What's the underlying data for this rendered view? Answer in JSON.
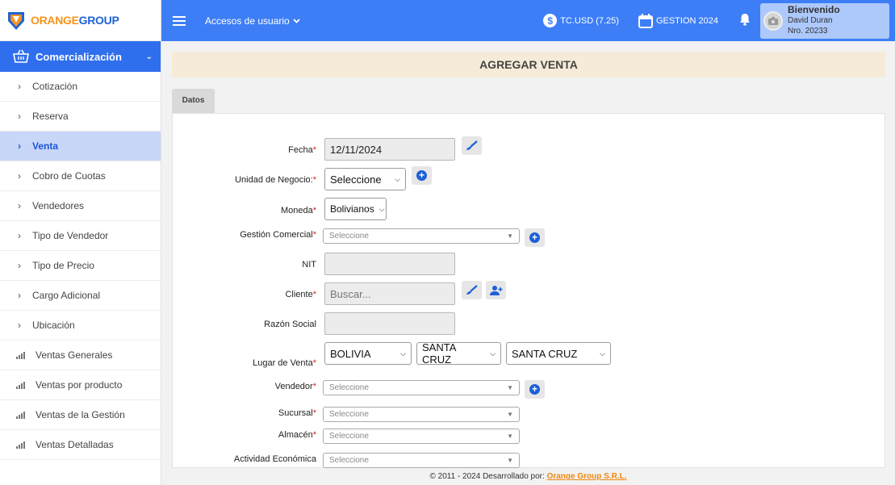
{
  "brand": {
    "name_a": "ORANGE",
    "name_b": "GROUP"
  },
  "sidebar": {
    "section": "Comercialización",
    "items": [
      {
        "label": "Cotización",
        "kind": "chevron"
      },
      {
        "label": "Reserva",
        "kind": "chevron"
      },
      {
        "label": "Venta",
        "kind": "chevron",
        "active": true
      },
      {
        "label": "Cobro de Cuotas",
        "kind": "chevron"
      },
      {
        "label": "Vendedores",
        "kind": "chevron"
      },
      {
        "label": "Tipo de Vendedor",
        "kind": "chevron"
      },
      {
        "label": "Tipo de Precio",
        "kind": "chevron"
      },
      {
        "label": "Cargo Adicional",
        "kind": "chevron"
      },
      {
        "label": "Ubicación",
        "kind": "chevron"
      },
      {
        "label": "Ventas Generales",
        "kind": "chart"
      },
      {
        "label": "Ventas por producto",
        "kind": "chart"
      },
      {
        "label": "Ventas de la Gestión",
        "kind": "chart"
      },
      {
        "label": "Ventas Detalladas",
        "kind": "chart"
      }
    ]
  },
  "topbar": {
    "accesos": "Accesos de usuario",
    "tc": "TC.USD (7.25)",
    "gestion": "GESTION 2024",
    "welcome": "Bienvenido",
    "user_name": "David Duran",
    "user_nro": "Nro. 20233"
  },
  "page": {
    "title": "AGREGAR VENTA",
    "tab": "Datos"
  },
  "form": {
    "fecha": {
      "label": "Fecha",
      "value": "12/11/2024"
    },
    "unidad": {
      "label": "Unidad de Negocio:",
      "value": "Seleccione"
    },
    "moneda": {
      "label": "Moneda",
      "value": "Bolivianos"
    },
    "gestion_comercial": {
      "label": "Gestión Comercial",
      "value": "Seleccione"
    },
    "nit": {
      "label": "NIT",
      "value": ""
    },
    "cliente": {
      "label": "Cliente",
      "placeholder": "Buscar..."
    },
    "razon": {
      "label": "Razón Social",
      "value": ""
    },
    "lugar": {
      "label": "Lugar de Venta",
      "pais": "BOLIVIA",
      "depto": "SANTA CRUZ",
      "ciudad": "SANTA CRUZ"
    },
    "vendedor": {
      "label": "Vendedor",
      "value": "Seleccione"
    },
    "sucursal": {
      "label": "Sucursal",
      "value": "Seleccione"
    },
    "almacen": {
      "label": "Almacén",
      "value": "Seleccione"
    },
    "actividad": {
      "label": "Actividad Económica",
      "value": "Seleccione"
    }
  },
  "footer": {
    "text": "© 2011 - 2024 Desarrollado por:",
    "link": "Orange Group S.R.L."
  },
  "colors": {
    "primary": "#3d7ef7",
    "accent": "#f7931e",
    "required": "#d9231d",
    "title_bg": "#f5ebd8"
  }
}
